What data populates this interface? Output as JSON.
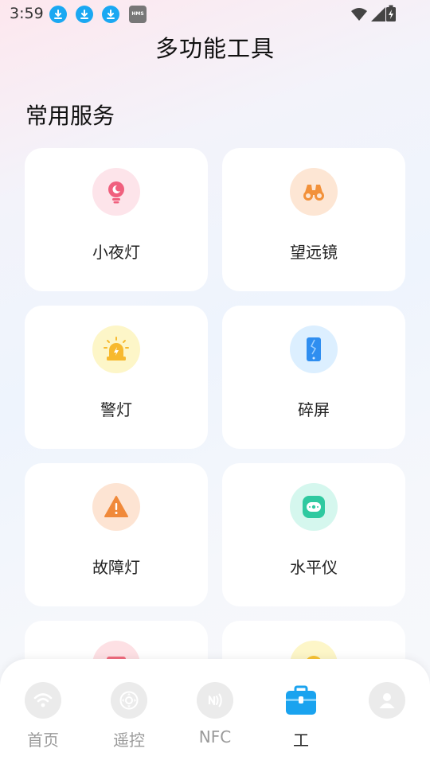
{
  "status_bar": {
    "time": "3:59",
    "notification_icons": [
      "download-icon",
      "download-icon",
      "download-icon",
      "hms-icon"
    ],
    "hms_label": "HMS",
    "system_icons": [
      "wifi-icon",
      "signal-icon",
      "battery-icon"
    ]
  },
  "header": {
    "title": "多功能工具"
  },
  "section": {
    "title": "常用服务"
  },
  "tools": [
    {
      "label": "小夜灯",
      "icon": "night-light-icon",
      "color": "#f0607e",
      "bg": "#fde4ea"
    },
    {
      "label": "望远镜",
      "icon": "binoculars-icon",
      "color": "#f2913a",
      "bg": "#fde6d4"
    },
    {
      "label": "警灯",
      "icon": "alarm-light-icon",
      "color": "#f7b92e",
      "bg": "#fdf6c8"
    },
    {
      "label": "碎屏",
      "icon": "broken-screen-icon",
      "color": "#2f8ef0",
      "bg": "#dcefff"
    },
    {
      "label": "故障灯",
      "icon": "warning-triangle-icon",
      "color": "#f0893a",
      "bg": "#fde4d3"
    },
    {
      "label": "水平仪",
      "icon": "level-icon",
      "color": "#2fc9a0",
      "bg": "#d5f7ee"
    },
    {
      "label": "",
      "icon": "partial-tool-icon",
      "color": "#f06b7e",
      "bg": "#fde0e4"
    },
    {
      "label": "",
      "icon": "partial-tool-icon",
      "color": "#f7c233",
      "bg": "#fdf6c8"
    }
  ],
  "tab_bar": {
    "tabs": [
      {
        "label": "首页",
        "icon": "wifi-icon"
      },
      {
        "label": "遥控",
        "icon": "remote-control-icon"
      },
      {
        "label": "NFC",
        "icon": "nfc-icon"
      },
      {
        "label": "工",
        "icon": "toolbox-icon",
        "active": true
      },
      {
        "label": "",
        "icon": "user-icon"
      }
    ]
  }
}
